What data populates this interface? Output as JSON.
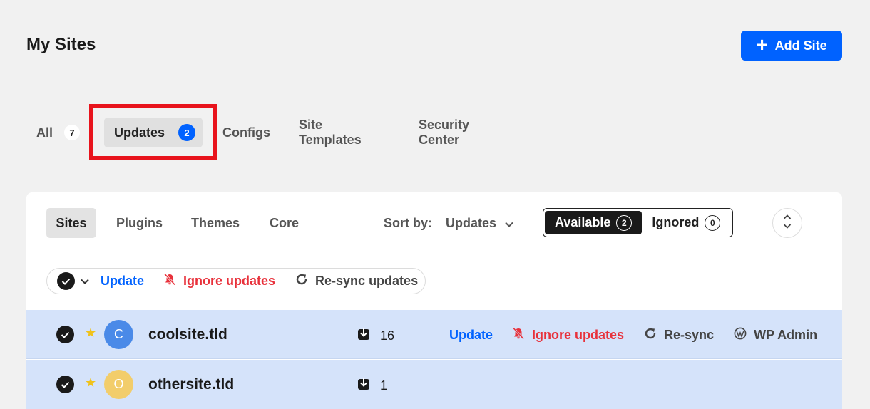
{
  "header": {
    "title": "My Sites",
    "add_site_label": "Add Site",
    "accent": "#0062ff"
  },
  "tabs": [
    {
      "label": "All",
      "count": "7"
    },
    {
      "label": "Updates",
      "count": "2",
      "active": true
    },
    {
      "label": "Configs"
    },
    {
      "label": "Site Templates"
    },
    {
      "label": "Security Center"
    }
  ],
  "filters": {
    "tabs": [
      "Sites",
      "Plugins",
      "Themes",
      "Core"
    ],
    "active": "Sites",
    "sort_label": "Sort by:",
    "sort_value": "Updates",
    "toggle": {
      "available_label": "Available",
      "available_count": "2",
      "ignored_label": "Ignored",
      "ignored_count": "0"
    }
  },
  "bulk_actions": {
    "update": "Update",
    "ignore": "Ignore updates",
    "resync": "Re-sync updates"
  },
  "sites": [
    {
      "initial": "C",
      "name": "coolsite.tld",
      "updates": "16",
      "avatar_color": "#4a8ae8",
      "actions": {
        "update": "Update",
        "ignore": "Ignore updates",
        "resync": "Re-sync",
        "wp_admin": "WP Admin"
      }
    },
    {
      "initial": "O",
      "name": "othersite.tld",
      "updates": "1",
      "avatar_color": "#f2cd6b"
    }
  ]
}
